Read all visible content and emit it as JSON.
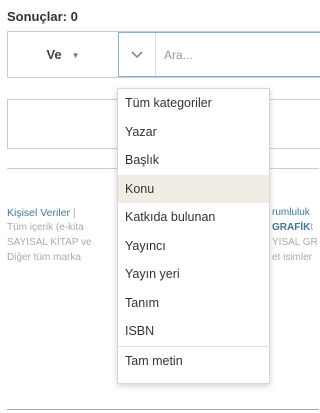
{
  "results": {
    "label": "Sonuçlar: 0"
  },
  "operator": {
    "label": "Ve"
  },
  "search": {
    "placeholder": "Ara..."
  },
  "footer": {
    "line1_link": "Kişisel Veriler",
    "line1_sep": "|",
    "line1_right": "rumluluk",
    "line2": "Tüm içerik (e-kita",
    "line2_right_bold": "GRAFİK",
    "line2_right": "t",
    "line3": "SAYISAL KİTAP ve",
    "line3_right": "YISAL GR",
    "line4": "Diğer tüm marka",
    "line4_right": "et isimler"
  },
  "dropdown": {
    "items": [
      "Tüm kategoriler",
      "Yazar",
      "Başlık",
      "Konu",
      "Katkıda bulunan",
      "Yayıncı",
      "Yayın yeri",
      "Tanım",
      "ISBN",
      "Tam metin"
    ],
    "highlighted_index": 3
  },
  "colors": {
    "link": "#3e7a95",
    "hover": "#f1ede4",
    "focus_border": "#7fb1d9"
  }
}
